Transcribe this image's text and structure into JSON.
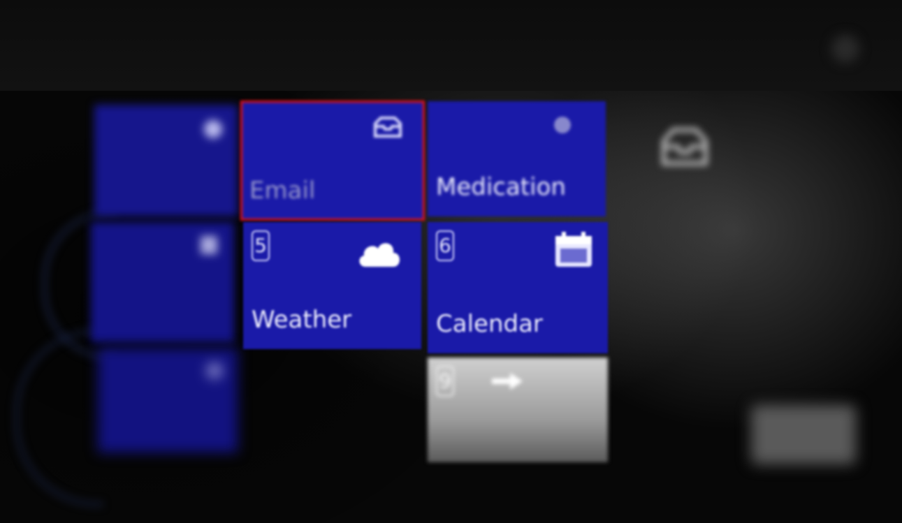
{
  "tiles": [
    {
      "id": "email",
      "label": "Email",
      "selected": true,
      "icon": "inbox-icon"
    },
    {
      "id": "medication",
      "label": "Medication",
      "icon": "pill-icon"
    },
    {
      "id": "weather",
      "num": "5",
      "label": "Weather",
      "icon": "cloud-icon"
    },
    {
      "id": "calendar",
      "num": "6",
      "label": "Calendar",
      "icon": "calendar-icon"
    },
    {
      "id": "next",
      "num": "9",
      "label": "",
      "icon": "arrow-right-icon"
    }
  ],
  "colors": {
    "tile_bg": "#1a1aa8",
    "selection": "#e11111",
    "gray_tile": "#bfbfbf"
  }
}
